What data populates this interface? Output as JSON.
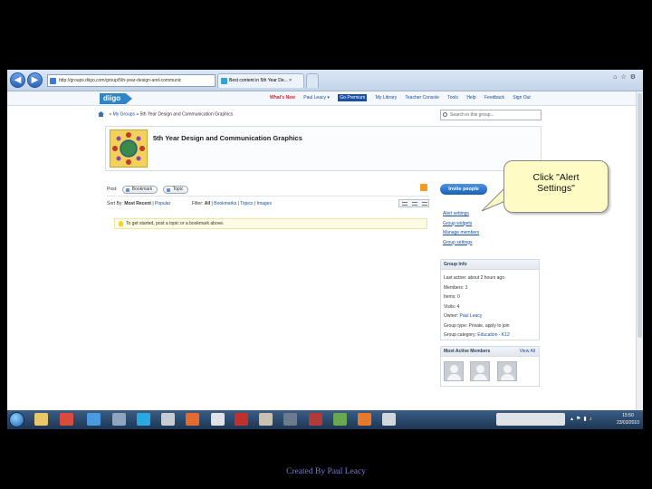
{
  "browser": {
    "address": "http://groups.diigo.com/group/5th-year-design-and-communic",
    "address_tools": "▾ ↻ ×",
    "tab_active": "Best content in 5th Year De... ×",
    "tab_new": ""
  },
  "toolbar": {
    "logo": "diigo",
    "whats_new": "What's New",
    "user": "Paul Leacy ▾",
    "go_premium": "Go Premium",
    "links": [
      "My Library",
      "Teacher Console",
      "Tools",
      "Help",
      "Feedback",
      "Sign Out"
    ]
  },
  "breadcrumb": {
    "my_groups": "My Groups",
    "sep": "»",
    "current": "5th Year Design and Communication Graphics"
  },
  "group_search": {
    "placeholder": "Search in this group..."
  },
  "group": {
    "title": "5th Year Design and Communication Graphics"
  },
  "post": {
    "label": "Post:",
    "bookmark": "Bookmark",
    "topic": "Topic"
  },
  "sort": {
    "label": "Sort By:",
    "most_recent": "Most Recent",
    "sep": "|",
    "popular": "Popular",
    "filter_label": "Filter:",
    "all": "All",
    "bookmarks": "Bookmarks",
    "topics": "Topics",
    "images": "Images"
  },
  "tip": {
    "text": "To get started, post a topic or a bookmark above."
  },
  "sidebar": {
    "invite": "Invite people",
    "links": [
      "Alert settings",
      "Group widgets",
      "Manage members",
      "Group settings"
    ],
    "groupinfo": {
      "title": "Group Info",
      "last_active_label": "Last active:",
      "last_active": "about 2 hours ago",
      "members_label": "Members:",
      "members": "3",
      "items_label": "Items:",
      "items": "0",
      "visits_label": "Visits:",
      "visits": "4",
      "owner_label": "Owner:",
      "owner": "Paul Leacy",
      "type_label": "Group type:",
      "type": "Private, apply to join",
      "category_label": "Group category:",
      "category": "Education - K12"
    },
    "members_panel": {
      "title": "Most Active Members",
      "view_all": "View All"
    }
  },
  "callout": {
    "line1": "Click \"Alert",
    "line2": "Settings\""
  },
  "taskbar": {
    "time": "15:50",
    "date": "23/03/2010"
  },
  "credit": "Created By Paul Leacy",
  "colors": {
    "accent": "#1a4fa0",
    "callout_bg": "#fffbc4",
    "taskbar": "#1d3553"
  }
}
